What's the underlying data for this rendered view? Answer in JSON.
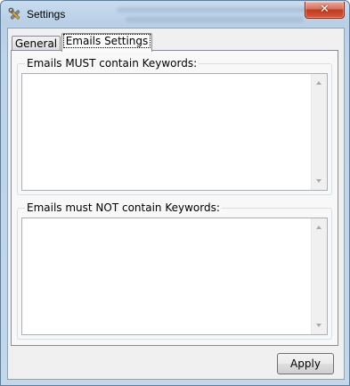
{
  "window": {
    "title": "Settings",
    "close_glyph": "✕"
  },
  "tabs": [
    {
      "label": "General",
      "selected": false
    },
    {
      "label": "Emails Settings",
      "selected": true
    }
  ],
  "groups": {
    "must_contain": {
      "label": "Emails MUST contain Keywords:",
      "value": ""
    },
    "must_not_contain": {
      "label": "Emails must NOT contain Keywords:",
      "value": ""
    }
  },
  "buttons": {
    "apply_label": "Apply"
  },
  "icons": {
    "app": "tools-settings-icon",
    "scroll_up": "scroll-up-arrow-icon",
    "scroll_down": "scroll-down-arrow-icon"
  },
  "colors": {
    "titlebar": "#c3d6ea",
    "close_button": "#c0391f",
    "dialog_background": "#f0f0f0"
  }
}
